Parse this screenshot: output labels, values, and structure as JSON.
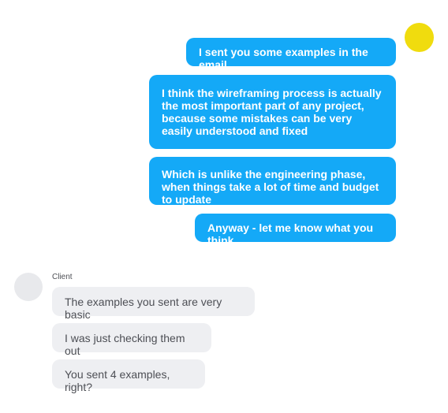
{
  "colors": {
    "outgoing_bubble": "#14a9f7",
    "incoming_bubble": "#eeeff2",
    "my_avatar": "#f0dc0e",
    "client_avatar": "#e8e9ec"
  },
  "outgoing": [
    {
      "text": "I sent you some examples in the email"
    },
    {
      "text": "I think the wireframing process is actually the most important part of any project, because some mistakes can be very easily understood and fixed"
    },
    {
      "text": "Which is unlike the engineering phase, when things take a lot of time and budget to update"
    },
    {
      "text": "Anyway - let me know what you think"
    }
  ],
  "client": {
    "name": "Client",
    "messages": [
      {
        "text": "The examples you sent are very basic"
      },
      {
        "text": "I was just checking them out"
      },
      {
        "text": "You sent 4 examples, right?"
      }
    ]
  }
}
